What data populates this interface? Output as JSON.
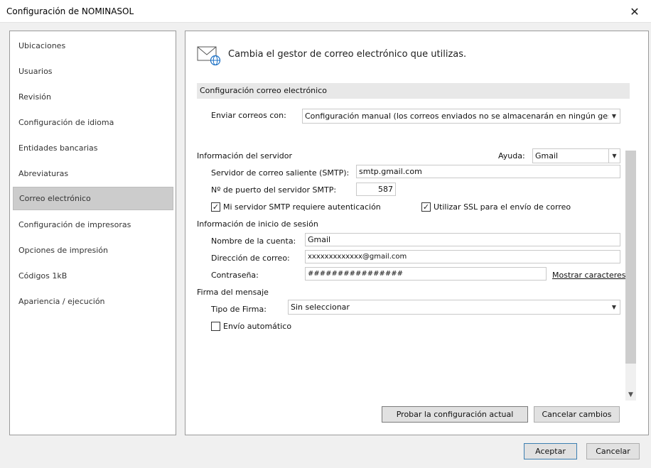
{
  "window": {
    "title": "Configuración de NOMINASOL",
    "close_glyph": "✕"
  },
  "nav": {
    "items": [
      {
        "label": "Ubicaciones"
      },
      {
        "label": "Usuarios"
      },
      {
        "label": "Revisión"
      },
      {
        "label": "Configuración de idioma"
      },
      {
        "label": "Entidades bancarias"
      },
      {
        "label": "Abreviaturas"
      },
      {
        "label": "Correo electrónico",
        "selected": true
      },
      {
        "label": "Configuración de impresoras"
      },
      {
        "label": "Opciones de impresión"
      },
      {
        "label": "Códigos 1kB"
      },
      {
        "label": "Apariencia / ejecución"
      }
    ]
  },
  "main": {
    "header_icon": "mail-globe-icon",
    "header": "Cambia el gestor de correo electrónico que utilizas.",
    "section_title": "Configuración correo electrónico",
    "send_with_label": "Enviar correos con:",
    "send_with_value": "Configuración manual (los correos enviados no se almacenarán en ningún gestor de correo)",
    "server_info_title": "Información del servidor",
    "help_label": "Ayuda:",
    "help_value": "Gmail",
    "smtp_label": "Servidor de correo saliente (SMTP):",
    "smtp_value": "smtp.gmail.com",
    "port_label": "Nº de puerto del servidor SMTP:",
    "port_value": "587",
    "auth_label": "Mi servidor SMTP requiere autenticación",
    "auth_checked": true,
    "ssl_label": "Utilizar SSL para el envío de correo",
    "ssl_checked": true,
    "login_title": "Información de inicio de sesión",
    "account_label": "Nombre de la cuenta:",
    "account_value": "Gmail",
    "email_label": "Dirección de correo:",
    "email_value": "xxxxxxxxxxxxx@gmail.com",
    "password_label": "Contraseña:",
    "password_value": "################",
    "show_chars_link": "Mostrar caracteres",
    "signature_title": "Firma del mensaje",
    "signature_type_label": "Tipo de Firma:",
    "signature_type_value": "Sin seleccionar",
    "auto_send_label": "Envío automático",
    "auto_send_checked": false,
    "test_button": "Probar la configuración actual",
    "cancel_changes_button": "Cancelar cambios"
  },
  "footer": {
    "accept_button": "Aceptar",
    "cancel_button": "Cancelar"
  },
  "colors": {
    "selected_nav": "#cccccc",
    "section_bar": "#e8e8e8",
    "accent_icon": "#1a6fc4"
  }
}
